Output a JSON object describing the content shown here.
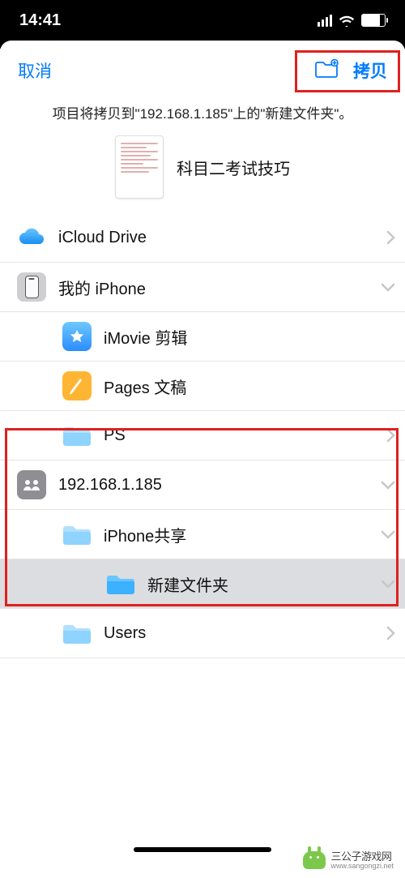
{
  "status": {
    "time": "14:41"
  },
  "nav": {
    "cancel": "取消",
    "copy": "拷贝"
  },
  "subtitle": "项目将拷贝到\"192.168.1.185\"上的\"新建文件夹\"。",
  "document": {
    "title": "科目二考试技巧"
  },
  "locations": {
    "icloud": "iCloud Drive",
    "my_iphone": "我的 iPhone",
    "imovie": "iMovie 剪辑",
    "pages": "Pages 文稿",
    "ps": "PS",
    "server": "192.168.1.185",
    "iphone_share": "iPhone共享",
    "new_folder": "新建文件夹",
    "users": "Users"
  },
  "watermark": {
    "name": "三公子游戏网",
    "url": "www.sangongzi.net"
  },
  "colors": {
    "accent": "#007aff",
    "folder": "#66c2ff",
    "folder_selected": "#2aa7ff",
    "highlight": "#e02020"
  }
}
